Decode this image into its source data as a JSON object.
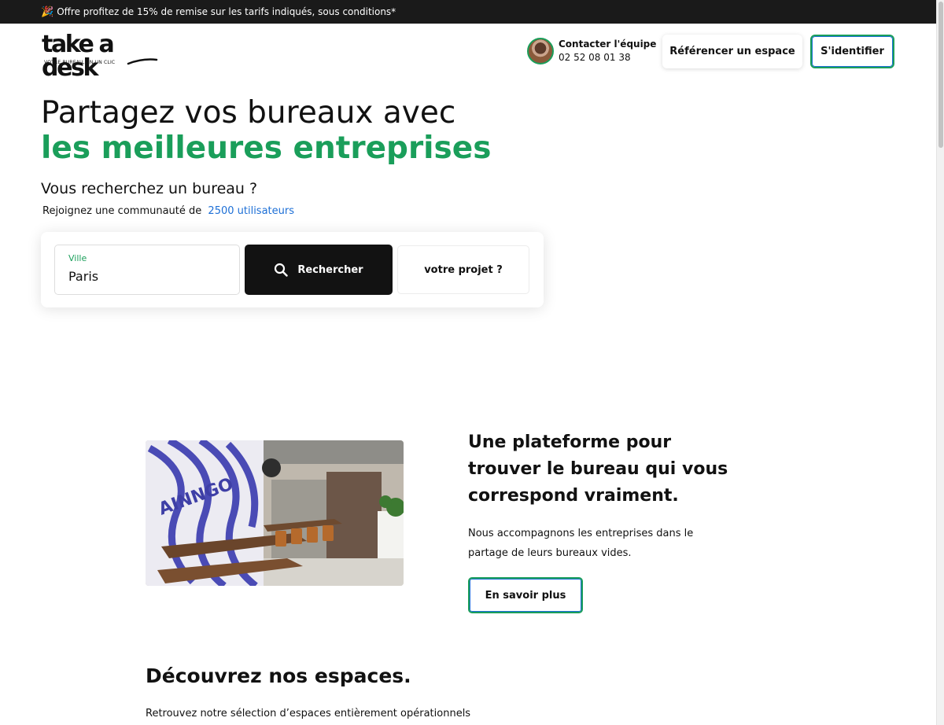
{
  "promo": {
    "icon": "party-popper-icon",
    "text": "Offre profitez de 15% de remise sur les tarifs indiqués, sous conditions*"
  },
  "header": {
    "logo": {
      "word": "take a desk",
      "tagline": "VOTRE BUREAU, EN UN CLIC"
    },
    "contact": {
      "title": "Contacter l'équipe",
      "phone": "02 52 08 01 38"
    },
    "list_space_label": "Référencer un espace",
    "login_label": "S'identifier"
  },
  "hero": {
    "title_line1": "Partagez vos bureaux avec",
    "title_line2": "les meilleures entreprises",
    "subtitle": "Vous recherchez un bureau ?",
    "join_text": "Rejoignez une communauté de",
    "join_users": "2500 utilisateurs"
  },
  "search": {
    "city_label": "Ville",
    "city_value": "Paris",
    "search_label": "Rechercher",
    "project_label": "votre projet ?"
  },
  "platform": {
    "title": "Une plateforme pour trouver le bureau qui vous correspond vraiment.",
    "description": "Nous accompagnons les entreprises dans le partage de leurs bureaux vides.",
    "cta_label": "En savoir plus"
  },
  "discover": {
    "title": "Découvrez nos espaces.",
    "description": "Retrouvez notre sélection d’espaces entièrement opérationnels"
  },
  "colors": {
    "brand_green": "#1a9e5a",
    "accent_blue": "#1d6fd6",
    "dark": "#121212"
  }
}
